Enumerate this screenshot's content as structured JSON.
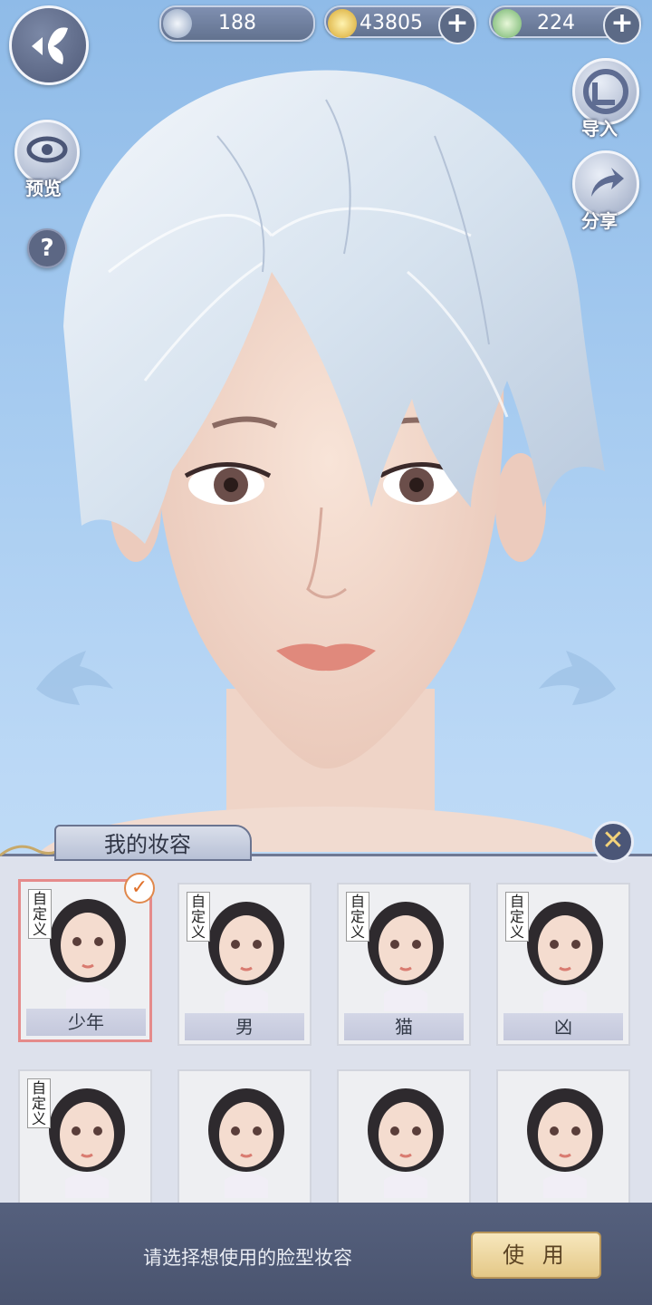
{
  "currencies": [
    {
      "icon": "silver-feather-coin-icon",
      "value": "188"
    },
    {
      "icon": "copper-coin-icon",
      "value": "43805"
    },
    {
      "icon": "jade-dragon-coin-icon",
      "value": "224"
    }
  ],
  "left_buttons": {
    "preview_label": "预览",
    "help_glyph": "?"
  },
  "right_buttons": {
    "import_label": "导入",
    "share_label": "分享"
  },
  "panel": {
    "title": "我的妆容",
    "custom_badge": "自定义",
    "presets": [
      {
        "name": "少年",
        "custom": true,
        "selected": true
      },
      {
        "name": "男",
        "custom": true,
        "selected": false
      },
      {
        "name": "猫",
        "custom": true,
        "selected": false
      },
      {
        "name": "凶",
        "custom": true,
        "selected": false
      },
      {
        "name": "",
        "custom": true,
        "selected": false
      },
      {
        "name": "",
        "custom": false,
        "selected": false
      },
      {
        "name": "",
        "custom": false,
        "selected": false
      },
      {
        "name": "",
        "custom": false,
        "selected": false
      }
    ]
  },
  "footer": {
    "hint": "请选择想使用的脸型妆容",
    "use_label": "使 用"
  },
  "colors": {
    "sky": "#a9cdf1",
    "panel": "#dde1ec",
    "footer": "#4a546f",
    "selected_border": "#e58b8b",
    "use_button": "#e4c887"
  }
}
